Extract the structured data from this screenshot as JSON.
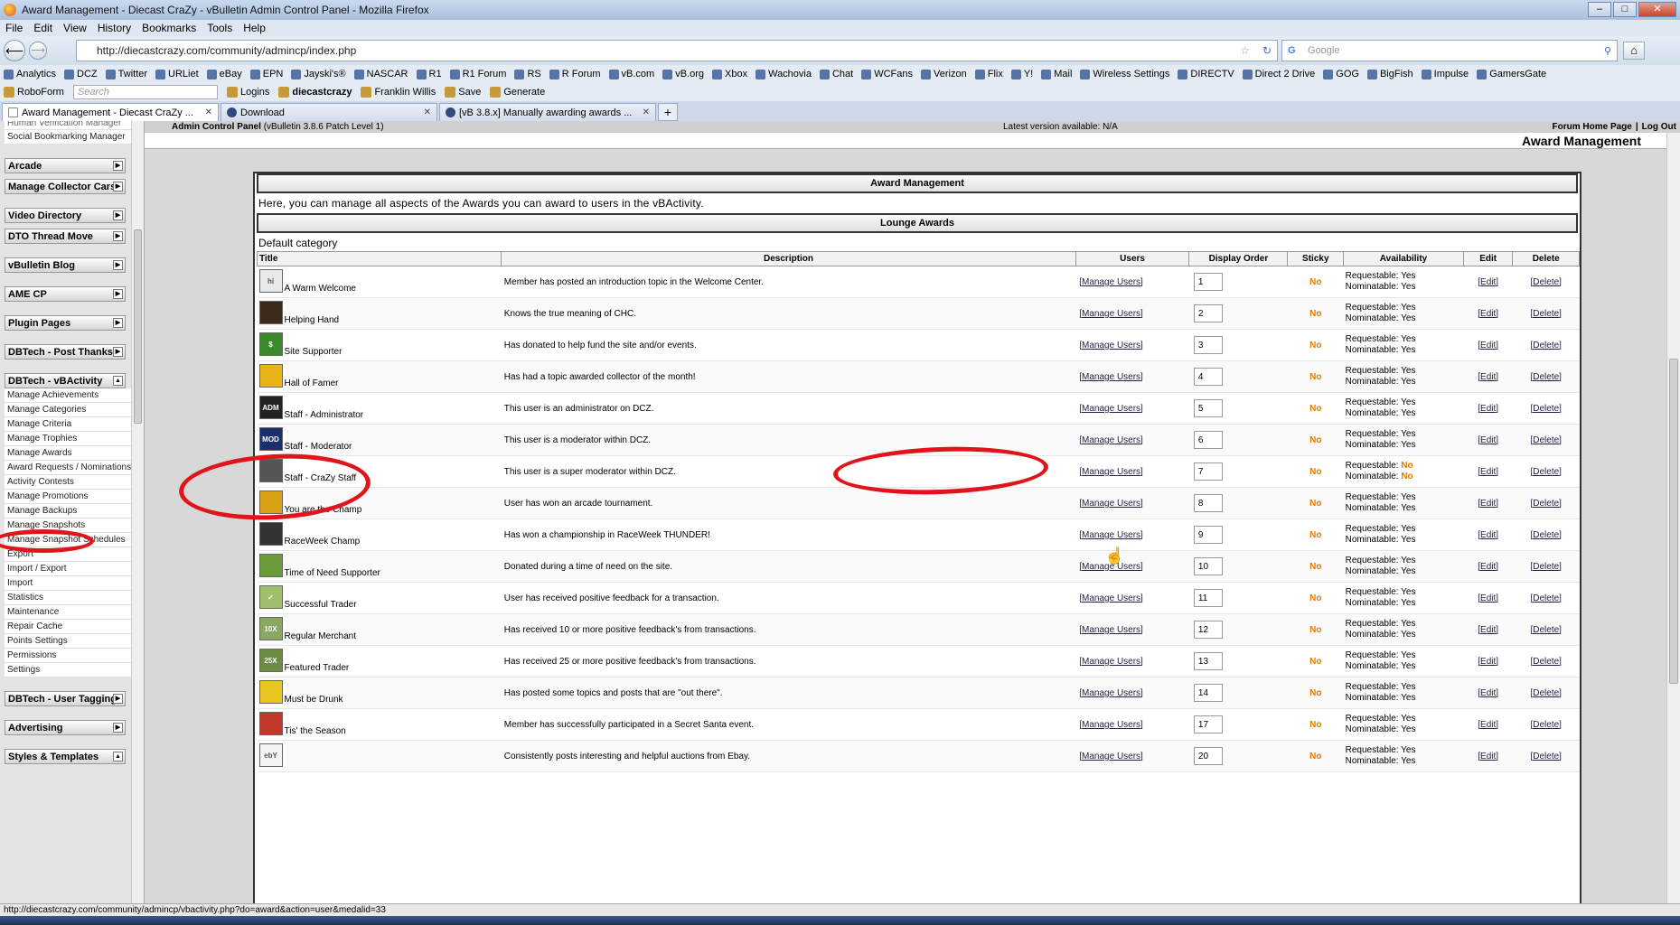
{
  "window": {
    "title": "Award Management - Diecast CraZy - vBulletin Admin Control Panel - Mozilla Firefox"
  },
  "menu": [
    "File",
    "Edit",
    "View",
    "History",
    "Bookmarks",
    "Tools",
    "Help"
  ],
  "nav": {
    "url": "http://diecastcrazy.com/community/admincp/index.php",
    "search_placeholder": "Google"
  },
  "bookmarks": [
    "Analytics",
    "DCZ",
    "Twitter",
    "URLiet",
    "eBay",
    "EPN",
    "Jayski's®",
    "NASCAR",
    "R1",
    "R1 Forum",
    "RS",
    "R Forum",
    "vB.com",
    "vB.org",
    "Xbox",
    "Wachovia",
    "Chat",
    "WCFans",
    "Verizon",
    "Flix",
    "Y!",
    "Mail",
    "Wireless Settings",
    "DIRECTV",
    "Direct 2 Drive",
    "GOG",
    "BigFish",
    "Impulse",
    "GamersGate"
  ],
  "toolbar2": {
    "roboform": "RoboForm",
    "search_placeholder": "Search",
    "logins": "Logins",
    "diecastcrazy": "diecastcrazy",
    "franklin": "Franklin Willis",
    "save": "Save",
    "generate": "Generate"
  },
  "tabs": [
    {
      "label": "Award Management - Diecast CraZy ..."
    },
    {
      "label": "Download"
    },
    {
      "label": "[vB 3.8.x] Manually awarding awards ..."
    }
  ],
  "sidebar": {
    "top_links": [
      "Human Verification Manager",
      "Social Bookmarking Manager"
    ],
    "headers": [
      "Arcade",
      "Manage Collector Cars",
      "Video Directory",
      "DTO Thread Move",
      "vBulletin Blog",
      "AME CP",
      "Plugin Pages",
      "DBTech - Post Thanks",
      "DBTech - vBActivity"
    ],
    "vbactivity_links": [
      "Manage Achievements",
      "Manage Categories",
      "Manage Criteria",
      "Manage Trophies",
      "Manage Awards",
      "Award Requests / Nominations",
      "Activity Contests",
      "Manage Promotions",
      "Manage Backups",
      "Manage Snapshots",
      "Manage Snapshot Schedules",
      "Export",
      "Import / Export",
      "Import",
      "Statistics",
      "Maintenance",
      "Repair Cache",
      "Points Settings",
      "Permissions",
      "Settings"
    ],
    "bottom_headers": [
      "DBTech - User Tagging",
      "Advertising",
      "Styles & Templates"
    ]
  },
  "cp": {
    "header_left_bold": "Admin Control Panel",
    "header_left": "(vBulletin 3.8.6 Patch Level 1)",
    "latest_version": "Latest version available: N/A",
    "forum_home": "Forum Home Page",
    "logout": "Log Out",
    "page_title": "Award Management"
  },
  "panel": {
    "title": "Award Management",
    "intro": "Here, you can manage all aspects of the Awards you can award to users in the vBActivity.",
    "section": "Lounge Awards",
    "category": "Default category",
    "columns": [
      "Title",
      "Description",
      "Users",
      "Display Order",
      "Sticky",
      "Availability",
      "Edit",
      "Delete"
    ]
  },
  "awards": [
    {
      "title": "A Warm Welcome",
      "desc": "Member has posted an introduction topic in the Welcome Center.",
      "users": "[Manage Users]",
      "order": "1",
      "sticky": "No",
      "req": "Requestable: Yes",
      "nom": "Nominatable: Yes",
      "edit": "[Edit]",
      "del": "[Delete]",
      "icon": "hi",
      "color": "#e8e8e8"
    },
    {
      "title": "Helping Hand",
      "desc": "Knows the true meaning of CHC.",
      "users": "[Manage Users]",
      "order": "2",
      "sticky": "No",
      "req": "Requestable: Yes",
      "nom": "Nominatable: Yes",
      "edit": "[Edit]",
      "del": "[Delete]",
      "icon": "",
      "color": "#3a2a1a"
    },
    {
      "title": "Site Supporter",
      "desc": "Has donated to help fund the site and/or events.",
      "users": "[Manage Users]",
      "order": "3",
      "sticky": "No",
      "req": "Requestable: Yes",
      "nom": "Nominatable: Yes",
      "edit": "[Edit]",
      "del": "[Delete]",
      "icon": "$",
      "color": "#3c8a2e"
    },
    {
      "title": "Hall of Famer",
      "desc": "Has had a topic awarded collector of the month!",
      "users": "[Manage Users]",
      "order": "4",
      "sticky": "No",
      "req": "Requestable: Yes",
      "nom": "Nominatable: Yes",
      "edit": "[Edit]",
      "del": "[Delete]",
      "icon": "",
      "color": "#e8b516"
    },
    {
      "title": "Staff - Administrator",
      "desc": "This user is an administrator on DCZ.",
      "users": "[Manage Users]",
      "order": "5",
      "sticky": "No",
      "req": "Requestable: Yes",
      "nom": "Nominatable: Yes",
      "edit": "[Edit]",
      "del": "[Delete]",
      "icon": "ADM",
      "color": "#222"
    },
    {
      "title": "Staff - Moderator",
      "desc": "This user is a moderator within DCZ.",
      "users": "[Manage Users]",
      "order": "6",
      "sticky": "No",
      "req": "Requestable: Yes",
      "nom": "Nominatable: Yes",
      "edit": "[Edit]",
      "del": "[Delete]",
      "icon": "MOD",
      "color": "#1a2f6b"
    },
    {
      "title": "Staff - CraZy Staff",
      "desc": "This user is a super moderator within DCZ.",
      "users": "[Manage Users]",
      "order": "7",
      "sticky": "No",
      "req": "Requestable: No",
      "nom": "Nominatable: No",
      "edit": "[Edit]",
      "del": "[Delete]",
      "icon": "",
      "color": "#555"
    },
    {
      "title": "You are the Champ",
      "desc": "User has won an arcade tournament.",
      "users": "[Manage Users]",
      "order": "8",
      "sticky": "No",
      "req": "Requestable: Yes",
      "nom": "Nominatable: Yes",
      "edit": "[Edit]",
      "del": "[Delete]",
      "icon": "",
      "color": "#d8a318"
    },
    {
      "title": "RaceWeek Champ",
      "desc": "Has won a championship in RaceWeek THUNDER!",
      "users": "[Manage Users]",
      "order": "9",
      "sticky": "No",
      "req": "Requestable: Yes",
      "nom": "Nominatable: Yes",
      "edit": "[Edit]",
      "del": "[Delete]",
      "icon": "",
      "color": "#333"
    },
    {
      "title": "Time of Need Supporter",
      "desc": "Donated during a time of need on the site.",
      "users": "[Manage Users]",
      "order": "10",
      "sticky": "No",
      "req": "Requestable: Yes",
      "nom": "Nominatable: Yes",
      "edit": "[Edit]",
      "del": "[Delete]",
      "icon": "",
      "color": "#6a9b3a"
    },
    {
      "title": "Successful Trader",
      "desc": "User has received positive feedback for a transaction.",
      "users": "[Manage Users]",
      "order": "11",
      "sticky": "No",
      "req": "Requestable: Yes",
      "nom": "Nominatable: Yes",
      "edit": "[Edit]",
      "del": "[Delete]",
      "icon": "✓",
      "color": "#9fbf6a"
    },
    {
      "title": "Regular Merchant",
      "desc": "Has received 10 or more positive feedback's from transactions.",
      "users": "[Manage Users]",
      "order": "12",
      "sticky": "No",
      "req": "Requestable: Yes",
      "nom": "Nominatable: Yes",
      "edit": "[Edit]",
      "del": "[Delete]",
      "icon": "10X",
      "color": "#8aa860"
    },
    {
      "title": "Featured Trader",
      "desc": "Has received 25 or more positive feedback's from transactions.",
      "users": "[Manage Users]",
      "order": "13",
      "sticky": "No",
      "req": "Requestable: Yes",
      "nom": "Nominatable: Yes",
      "edit": "[Edit]",
      "del": "[Delete]",
      "icon": "25X",
      "color": "#6d8c42"
    },
    {
      "title": "Must be Drunk",
      "desc": "Has posted some topics and posts that are \"out there\".",
      "users": "[Manage Users]",
      "order": "14",
      "sticky": "No",
      "req": "Requestable: Yes",
      "nom": "Nominatable: Yes",
      "edit": "[Edit]",
      "del": "[Delete]",
      "icon": "",
      "color": "#e8c520"
    },
    {
      "title": "Tis' the Season",
      "desc": "Member has successfully participated in a Secret Santa event.",
      "users": "[Manage Users]",
      "order": "17",
      "sticky": "No",
      "req": "Requestable: Yes",
      "nom": "Nominatable: Yes",
      "edit": "[Edit]",
      "del": "[Delete]",
      "icon": "",
      "color": "#c0392b"
    },
    {
      "title": "",
      "desc": "Consistently posts interesting and helpful auctions from Ebay.",
      "users": "[Manage Users]",
      "order": "20",
      "sticky": "No",
      "req": "Requestable: Yes",
      "nom": "Nominatable: Yes",
      "edit": "[Edit]",
      "del": "[Delete]",
      "icon": "ebY",
      "color": "#f4f4f4"
    }
  ],
  "status": "http://diecastcrazy.com/community/admincp/vbactivity.php?do=award&action=user&medalid=33"
}
